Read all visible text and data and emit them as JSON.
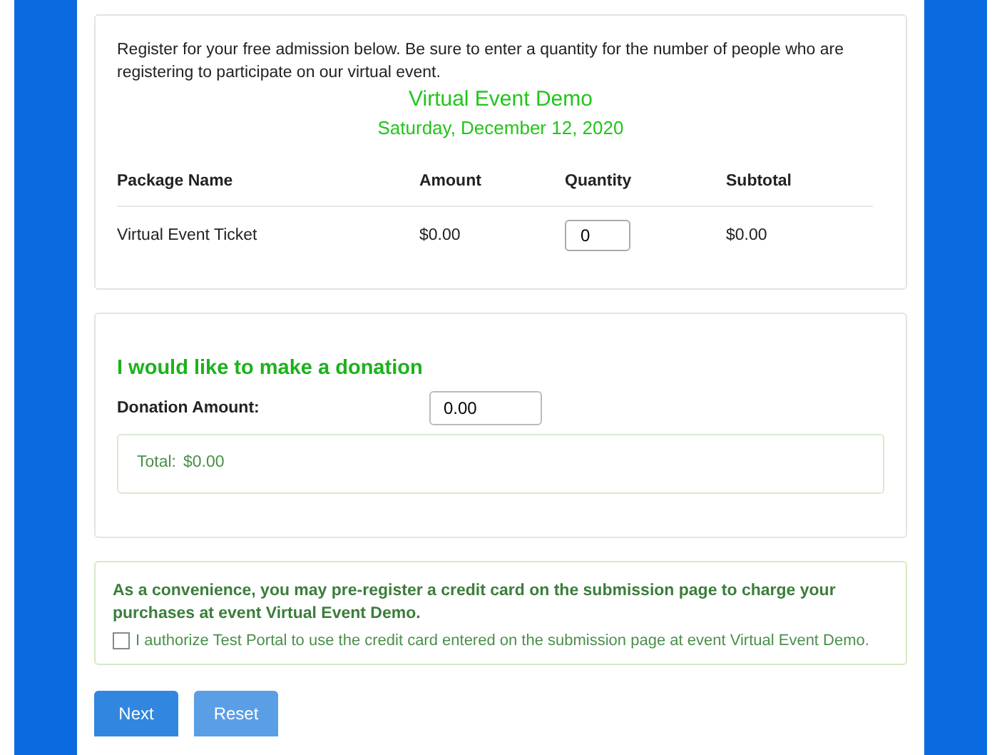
{
  "intro": "Register for your free admission below. Be sure to enter a quantity for the number of people who are registering to participate on our virtual event.",
  "event": {
    "name": "Virtual Event Demo",
    "date": "Saturday, December 12, 2020"
  },
  "table": {
    "columns": [
      "Package Name",
      "Amount",
      "Quantity",
      "Subtotal"
    ],
    "rows": [
      {
        "package": "Virtual Event Ticket",
        "amount": "$0.00",
        "quantity": "0",
        "subtotal": "$0.00"
      }
    ]
  },
  "donation": {
    "heading": "I would like to make a donation",
    "label": "Donation Amount:",
    "value": "0.00",
    "total_label": "Total:",
    "total": "$0.00"
  },
  "credit_card": {
    "notice": "As a convenience, you may pre-register a credit card on the submission page to charge your purchases at event Virtual Event Demo.",
    "authorize": {
      "label": "I authorize Test Portal to use the credit card entered on the submission page at event Virtual Event Demo.",
      "checked": false
    }
  },
  "buttons": [
    "Next",
    "Reset"
  ]
}
